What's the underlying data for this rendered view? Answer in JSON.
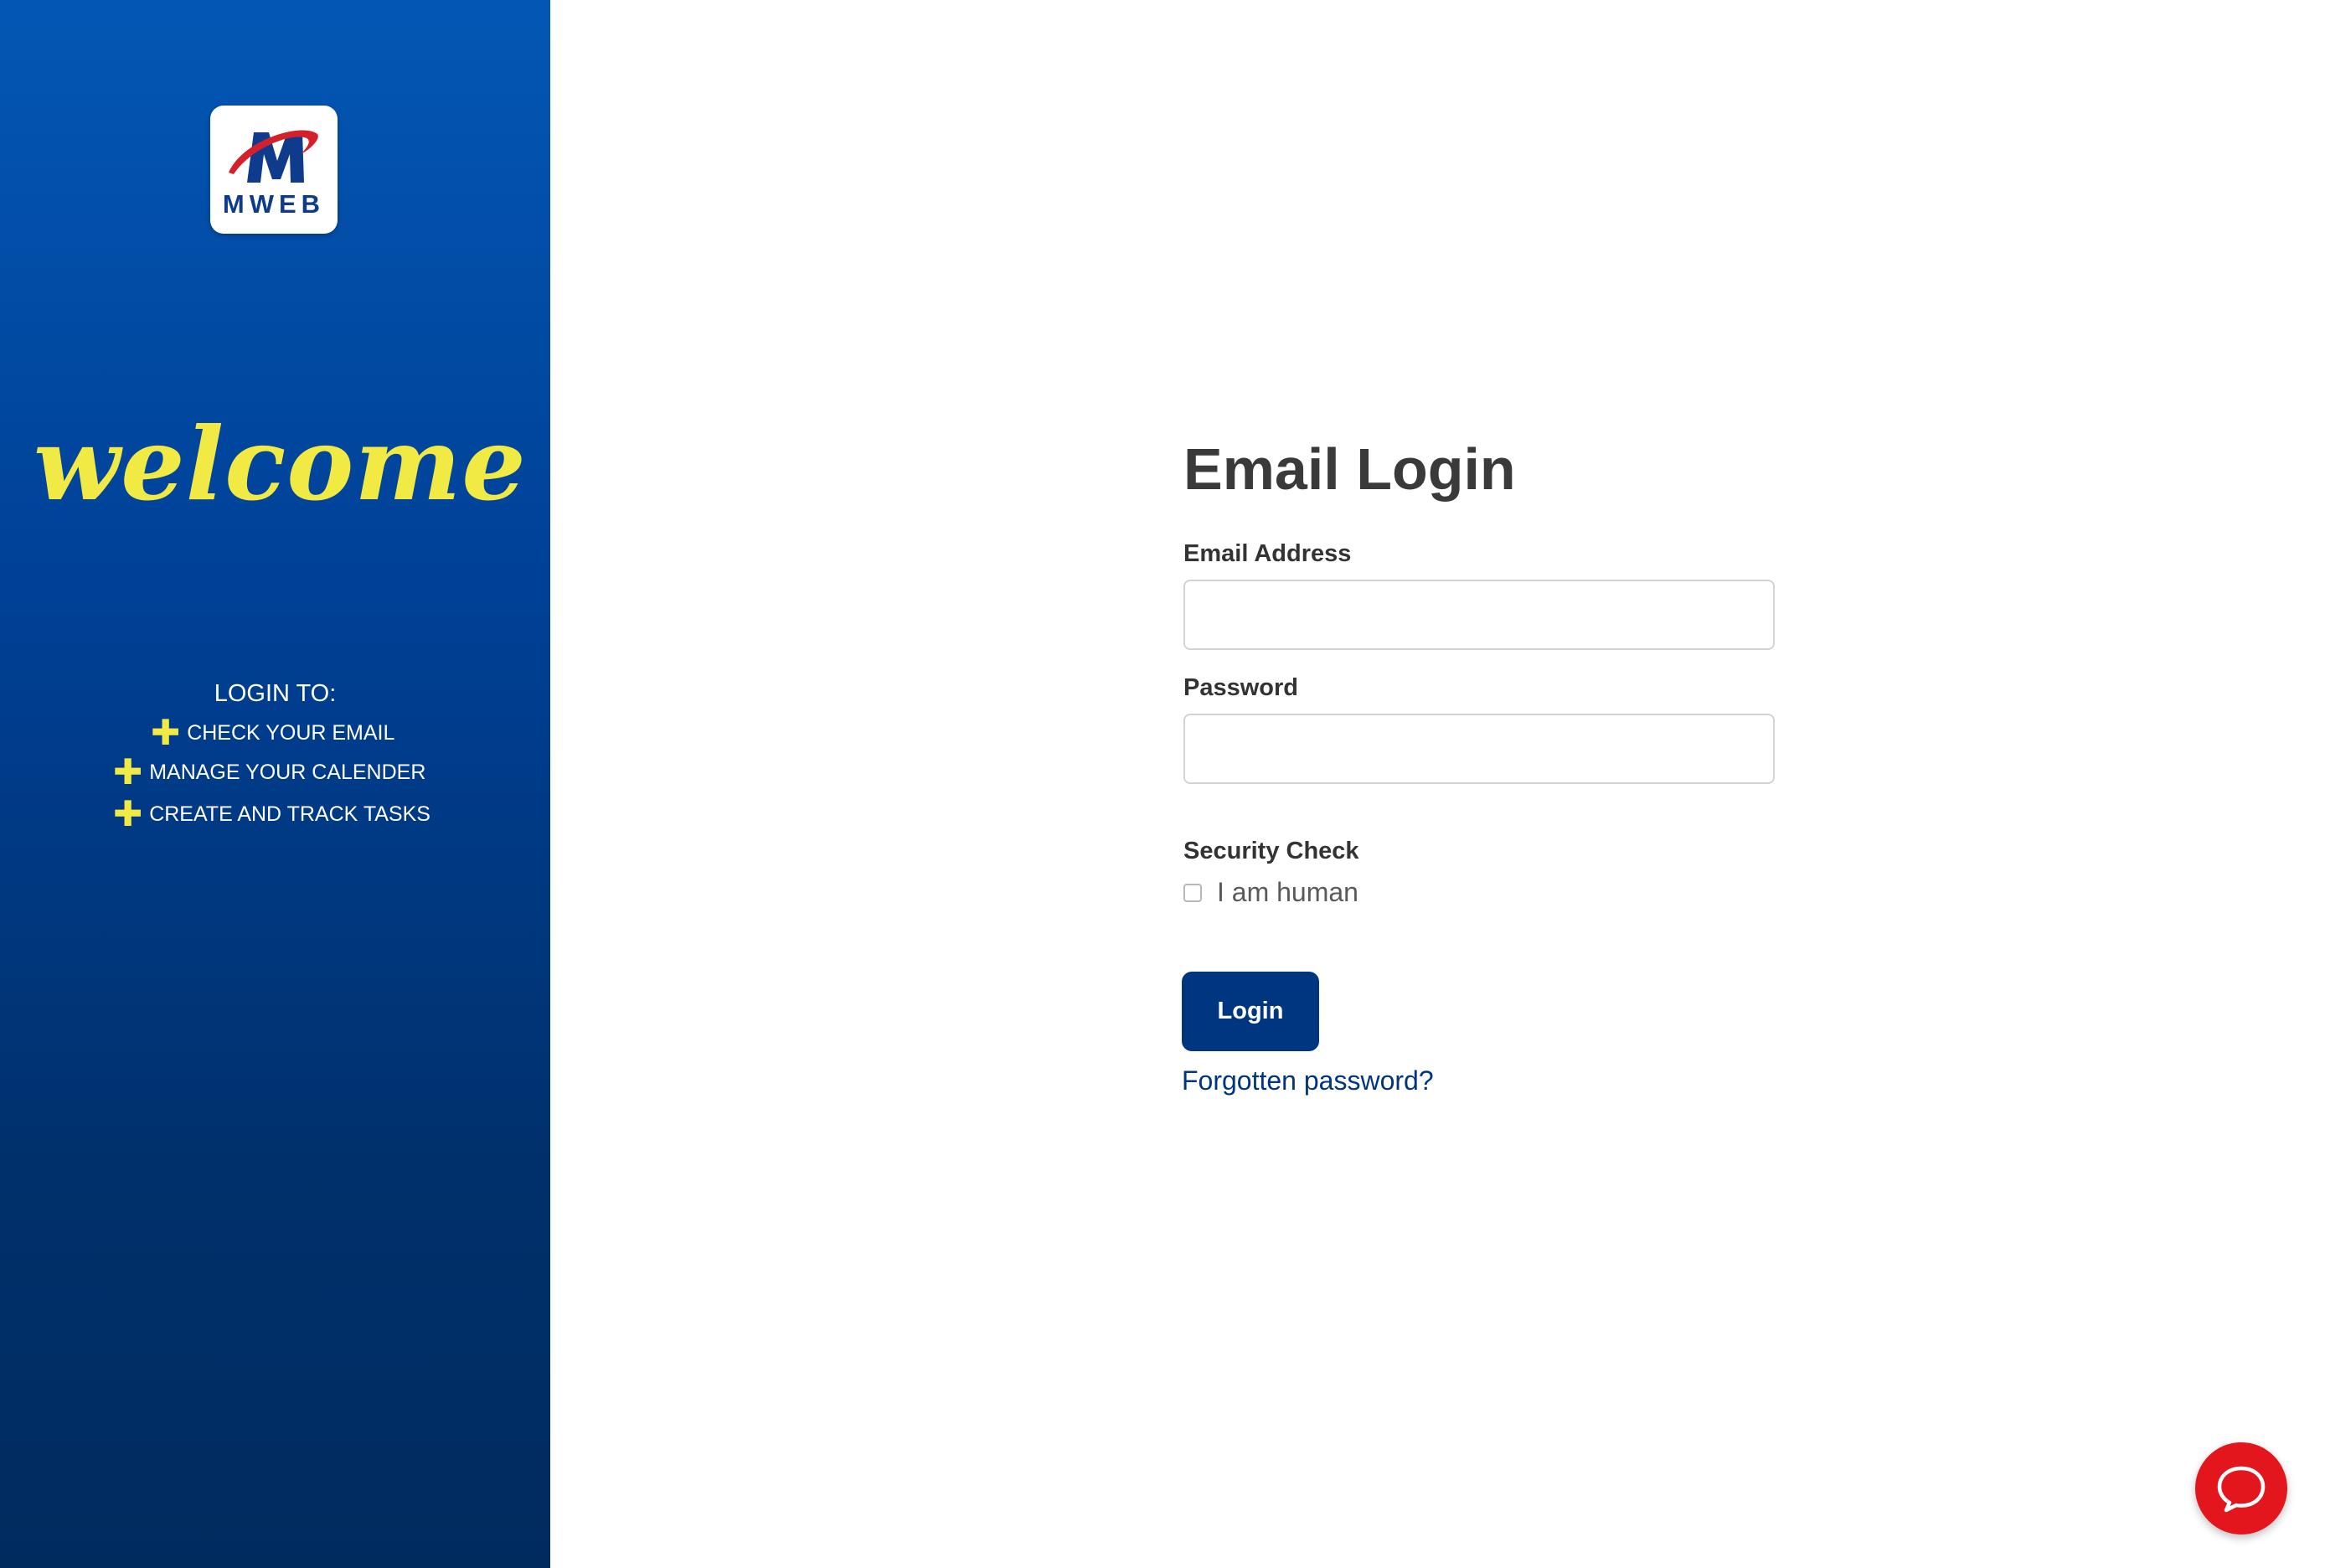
{
  "sidebar": {
    "logo_text": "MWEB",
    "welcome_text": "welcome",
    "login_to": "LOGIN TO:",
    "features": [
      {
        "icon": "plus-icon",
        "label": "CHECK YOUR EMAIL"
      },
      {
        "icon": "plus-icon",
        "label": "MANAGE YOUR CALENDER"
      },
      {
        "icon": "plus-icon",
        "label": "CREATE AND TRACK TASKS"
      }
    ]
  },
  "form": {
    "title": "Email Login",
    "email_label": "Email Address",
    "email_value": "",
    "password_label": "Password",
    "password_value": "",
    "security_label": "Security Check",
    "human_checkbox_label": "I am human",
    "human_checked": false,
    "login_button": "Login",
    "forgot_link": "Forgotten password?"
  },
  "chat": {
    "icon": "chat-bubble-icon"
  },
  "colors": {
    "sidebar_top": "#0357b4",
    "sidebar_bottom": "#002b5f",
    "accent_yellow": "#f2ea44",
    "button_blue": "#00367f",
    "chat_red": "#e3161d",
    "logo_red": "#d3202a"
  }
}
